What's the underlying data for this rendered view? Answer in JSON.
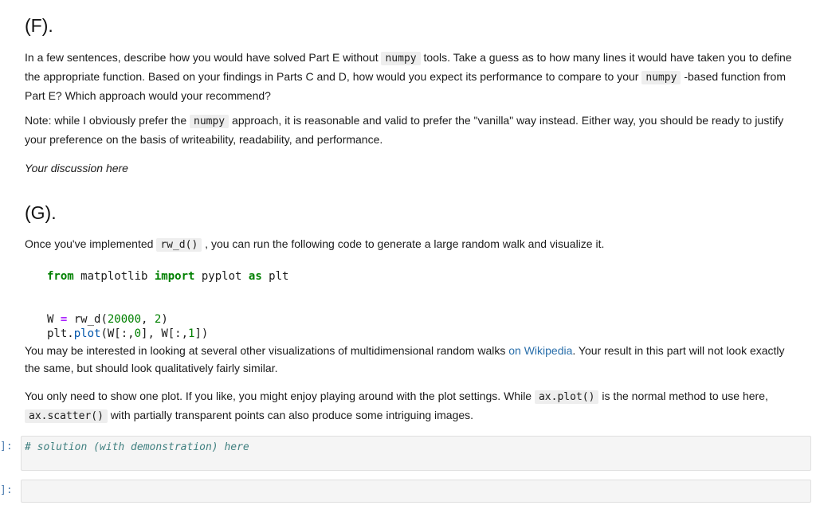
{
  "section_f": {
    "heading": "(F).",
    "p1": {
      "t1": "In a few sentences, describe how you would have solved Part E without ",
      "c1": "numpy",
      "t2": " tools. Take a guess as to how many lines it would have taken you to define the appropriate function. Based on your findings in Parts C and D, how would you expect its performance to compare to your ",
      "c2": "numpy",
      "t3": " -based function from Part E? Which approach would your recommend?"
    },
    "p2": {
      "t1": "Note: while I obviously prefer the ",
      "c1": "numpy",
      "t2": " approach, it is reasonable and valid to prefer the \"vanilla\" way instead. Either way, you should be ready to justify your preference on the basis of writeability, readability, and performance."
    },
    "discussion": "Your discussion here"
  },
  "section_g": {
    "heading": "(G).",
    "p1": {
      "t1": "Once you've implemented ",
      "c1": "rw_d()",
      "t2": " , you can run the following code to generate a large random walk and visualize it."
    },
    "code": {
      "line1": {
        "kw_from": "from",
        "mod": " matplotlib ",
        "kw_import": "import",
        "name": " pyplot ",
        "kw_as": "as",
        "alias": " plt"
      },
      "line2": {
        "var": "W ",
        "eq": "=",
        "call": " rw_d(",
        "n1": "20000",
        "sep": ", ",
        "n2": "2",
        "close": ")"
      },
      "line3": {
        "obj": "plt.",
        "method": "plot",
        "args_a": "(W[:,",
        "n0": "0",
        "args_b": "], W[:,",
        "n1": "1",
        "args_c": "])"
      }
    },
    "p2": {
      "t1": "You may be interested in looking at several other visualizations of multidimensional random walks ",
      "link": "on Wikipedia",
      "t2": ". Your result in this part will not look exactly the same, but should look qualitatively fairly similar."
    },
    "p3": {
      "t1": "You only need to show one plot. If you like, you might enjoy playing around with the plot settings. While ",
      "c1": "ax.plot()",
      "t2": " is the normal method to use here, ",
      "c2": "ax.scatter()",
      "t3": " with partially transparent points can also produce some intriguing images."
    }
  },
  "cells": [
    {
      "prompt": "]:",
      "content": "# solution (with demonstration) here"
    },
    {
      "prompt": "]:",
      "content": ""
    }
  ]
}
